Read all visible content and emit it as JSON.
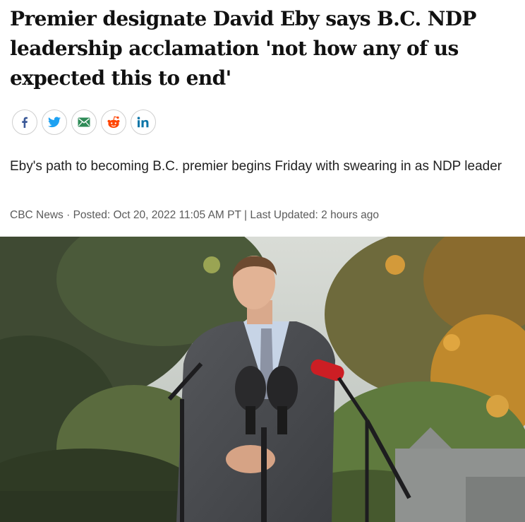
{
  "article": {
    "headline": "Premier designate David Eby says B.C. NDP leadership acclamation 'not how any of us expected this to end'",
    "deck": "Eby's path to becoming B.C. premier begins Friday with swearing in as NDP leader",
    "source": "CBC News",
    "separator_dot": " · ",
    "posted_label": "Posted: Oct 20, 2022 11:05 AM PT",
    "separator_pipe": " | ",
    "updated_label": "Last Updated: 2 hours ago"
  },
  "share": {
    "buttons": [
      {
        "name": "facebook",
        "icon": "facebook-icon",
        "color": "#3b5998"
      },
      {
        "name": "twitter",
        "icon": "twitter-icon",
        "color": "#1da1f2"
      },
      {
        "name": "email",
        "icon": "email-icon",
        "color": "#2e8b57"
      },
      {
        "name": "reddit",
        "icon": "reddit-icon",
        "color": "#ff4500"
      },
      {
        "name": "linkedin",
        "icon": "linkedin-icon",
        "color": "#0e76a8"
      }
    ]
  }
}
